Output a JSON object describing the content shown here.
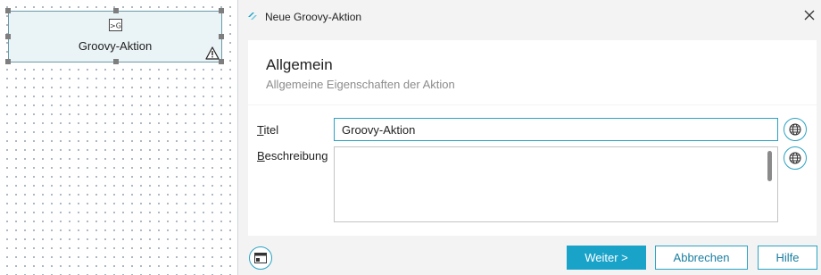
{
  "canvas": {
    "node": {
      "icon": "groovy-script-icon",
      "icon_text": ">G",
      "title": "Groovy-Aktion",
      "warning_icon": "warning-triangle-icon"
    }
  },
  "dialog": {
    "title": "Neue Groovy-Aktion",
    "app_icon": "app-logo-icon",
    "close_icon": "close-icon",
    "header": {
      "title": "Allgemein",
      "subtitle": "Allgemeine Eigenschaften der Aktion"
    },
    "form": {
      "title_label_mnemonic": "T",
      "title_label_rest": "itel",
      "title_value": "Groovy-Aktion",
      "description_label_mnemonic": "B",
      "description_label_rest": "eschreibung",
      "description_value": "",
      "translate_icon": "globe-icon"
    },
    "footer": {
      "left_icon": "window-layout-icon",
      "next_label": "Weiter >",
      "cancel_label": "Abbrechen",
      "help_label": "Hilfe"
    },
    "colors": {
      "accent": "#1aa3c9",
      "node_fill": "#eaf3f5",
      "node_border": "#6c9aa8"
    }
  }
}
